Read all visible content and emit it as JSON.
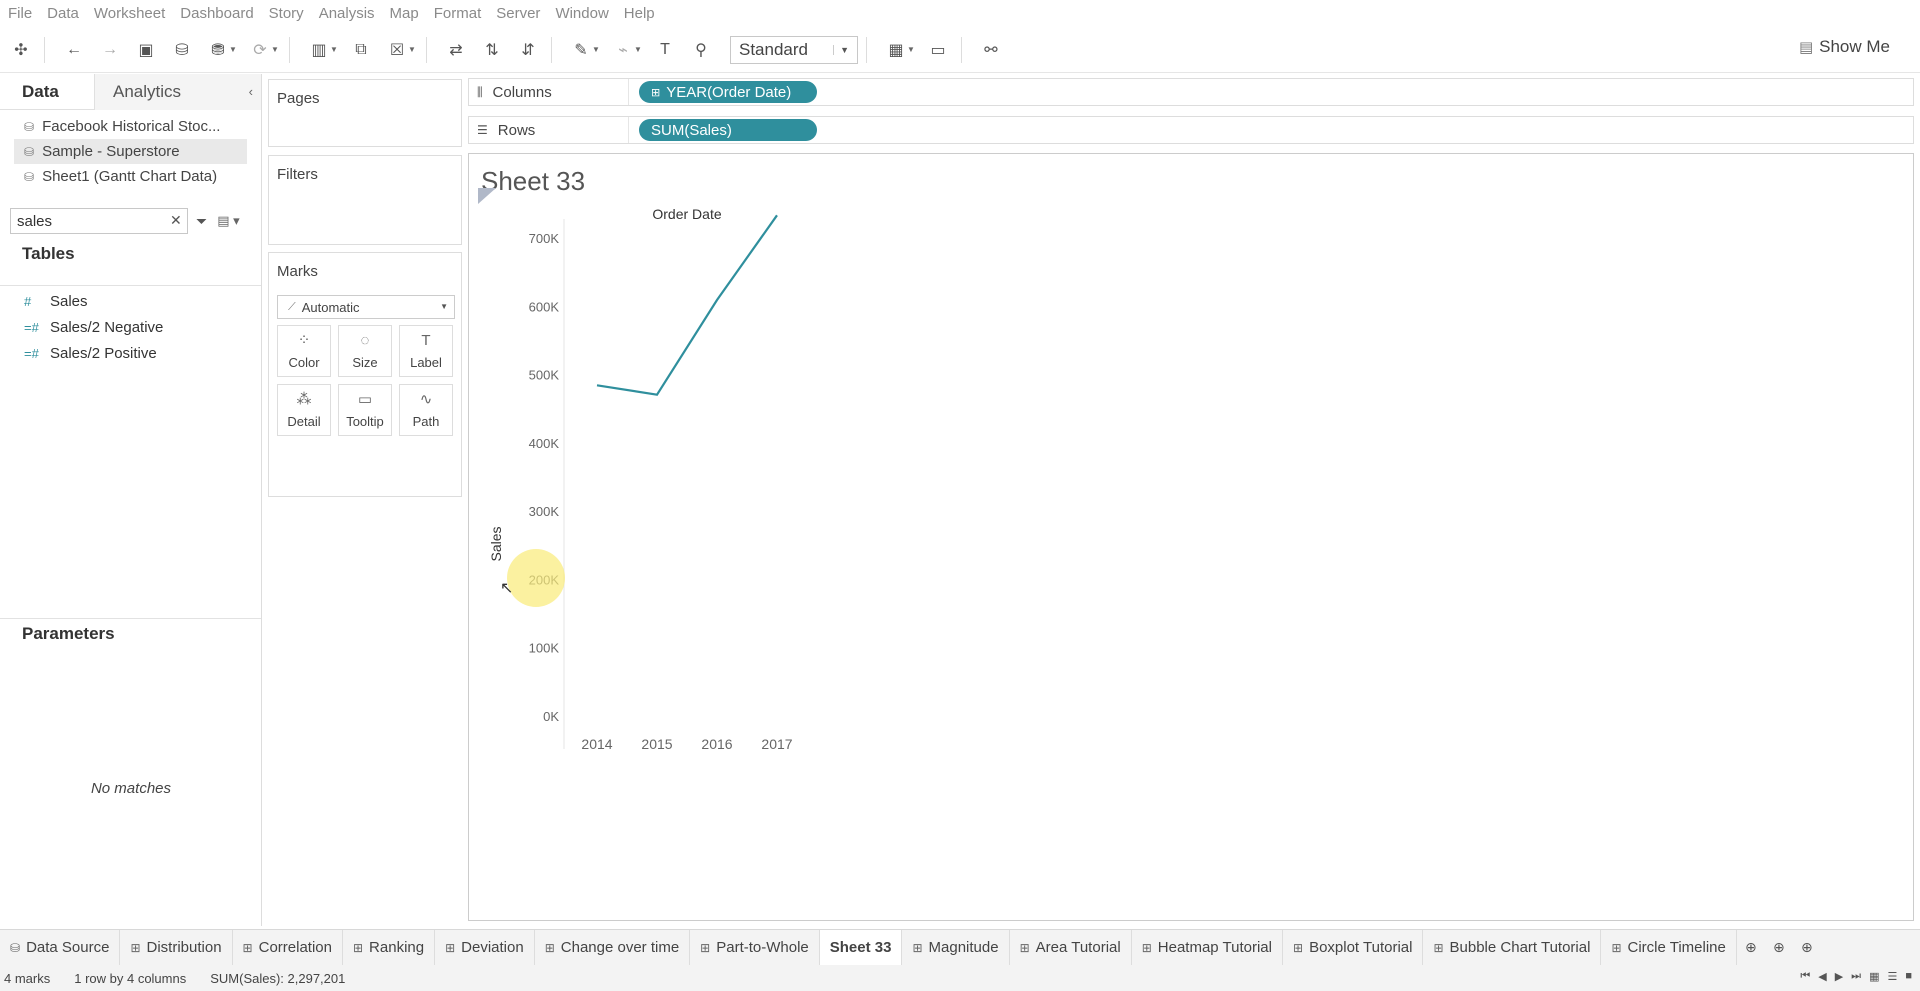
{
  "menu": [
    "File",
    "Data",
    "Worksheet",
    "Dashboard",
    "Story",
    "Analysis",
    "Map",
    "Format",
    "Server",
    "Window",
    "Help"
  ],
  "toolbar": {
    "fit": "Standard",
    "show_me": "Show Me"
  },
  "left_pane": {
    "tabs": {
      "data": "Data",
      "analytics": "Analytics"
    },
    "data_sources": [
      "Facebook Historical Stoc...",
      "Sample - Superstore",
      "Sheet1 (Gantt Chart Data)"
    ],
    "search_value": "sales",
    "tables_title": "Tables",
    "fields": [
      "Sales",
      "Sales/2 Negative",
      "Sales/2 Positive"
    ],
    "parameters_title": "Parameters",
    "no_matches": "No matches"
  },
  "cards": {
    "pages": "Pages",
    "filters": "Filters",
    "marks": "Marks",
    "mark_type": "Automatic",
    "mark_buttons": [
      "Color",
      "Size",
      "Label",
      "Detail",
      "Tooltip",
      "Path"
    ]
  },
  "shelves": {
    "columns_label": "Columns",
    "columns_pill": "YEAR(Order Date)",
    "rows_label": "Rows",
    "rows_pill": "SUM(Sales)"
  },
  "sheet_title": "Sheet 33",
  "chart_data": {
    "type": "line",
    "title": "Order Date",
    "xlabel": "",
    "ylabel": "Sales",
    "categories": [
      "2014",
      "2015",
      "2016",
      "2017"
    ],
    "values": [
      484247,
      470533,
      609206,
      733215
    ],
    "ylim": [
      0,
      800000
    ],
    "yticks": [
      "0K",
      "100K",
      "200K",
      "300K",
      "400K",
      "500K",
      "600K",
      "700K"
    ],
    "line_color": "#2f8f9d"
  },
  "sheet_tabs": [
    "Data Source",
    "Distribution",
    "Correlation",
    "Ranking",
    "Deviation",
    "Change over time",
    "Part-to-Whole",
    "Sheet 33",
    "Magnitude",
    "Area Tutorial",
    "Heatmap Tutorial",
    "Boxplot Tutorial",
    "Bubble Chart Tutorial",
    "Circle Timeline"
  ],
  "active_tab": "Sheet 33",
  "status": {
    "marks": "4 marks",
    "dims": "1 row by 4 columns",
    "sum": "SUM(Sales): 2,297,201"
  }
}
